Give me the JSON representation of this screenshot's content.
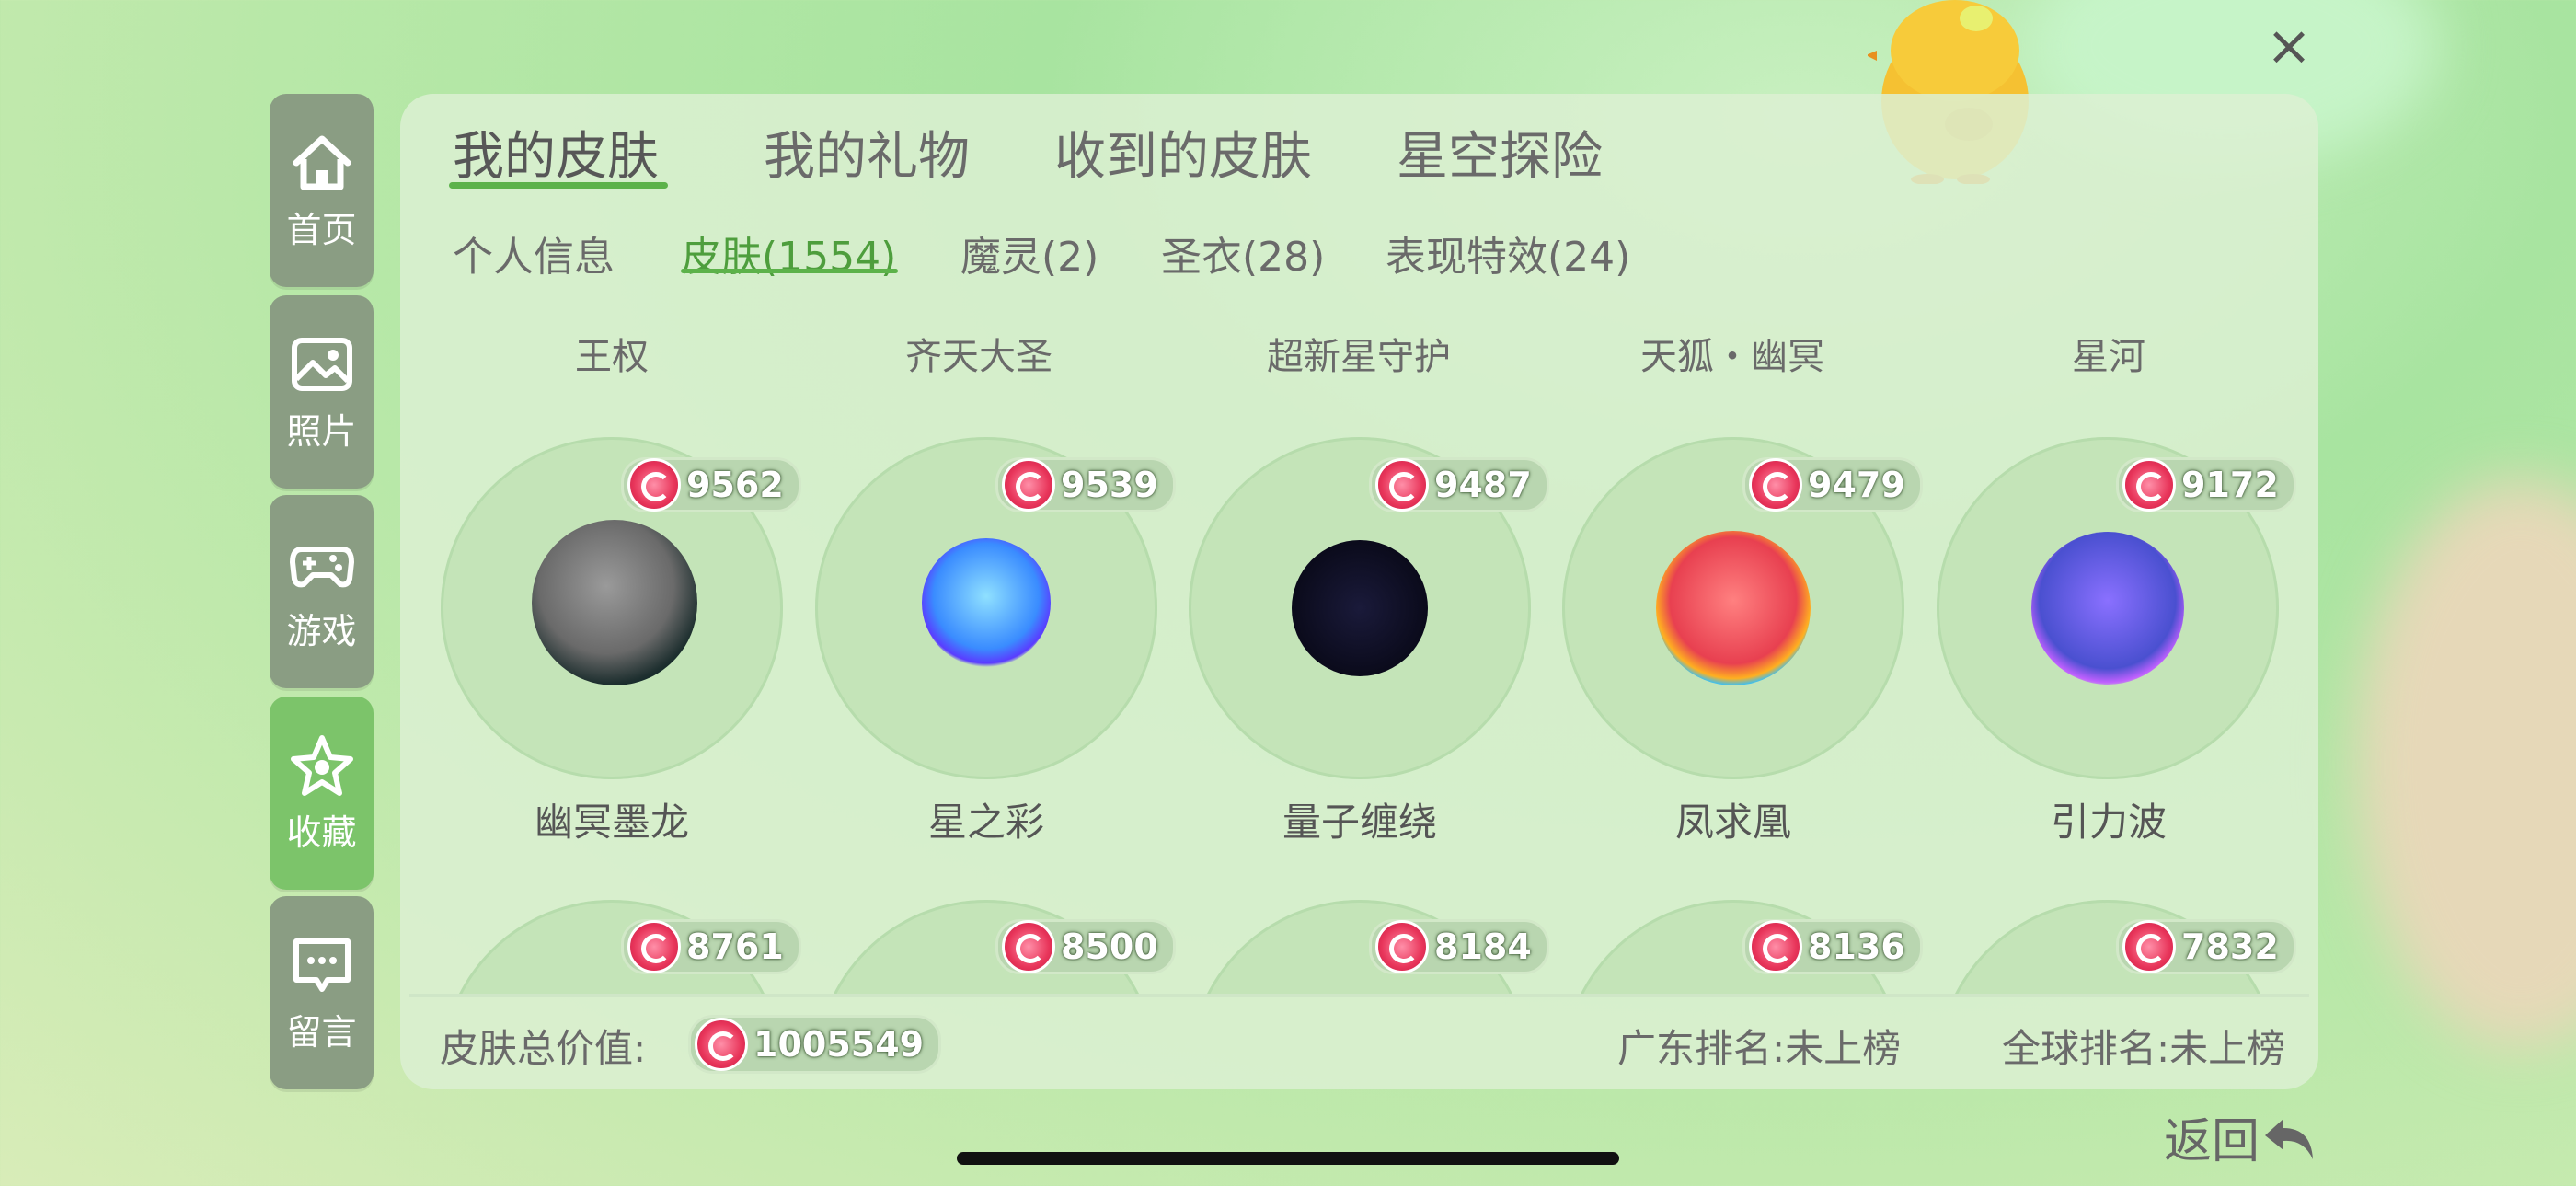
{
  "sidebar": [
    {
      "label": "首页",
      "icon": "home-icon"
    },
    {
      "label": "照片",
      "icon": "photo-icon"
    },
    {
      "label": "游戏",
      "icon": "gamepad-icon"
    },
    {
      "label": "收藏",
      "icon": "star-icon",
      "active": true
    },
    {
      "label": "留言",
      "icon": "message-icon"
    }
  ],
  "tabs": [
    "我的皮肤",
    "我的礼物",
    "收到的皮肤",
    "星空探险"
  ],
  "subtabs": [
    "个人信息",
    "皮肤(1554)",
    "魔灵(2)",
    "圣衣(28)",
    "表现特效(24)"
  ],
  "top_titles": [
    "王权",
    "齐天大圣",
    "超新星守护",
    "天狐・幽冥",
    "星河"
  ],
  "skins": [
    {
      "name": "幽冥墨龙",
      "value": "9562"
    },
    {
      "name": "星之彩",
      "value": "9539"
    },
    {
      "name": "量子缠绕",
      "value": "9487"
    },
    {
      "name": "凤求凰",
      "value": "9479"
    },
    {
      "name": "引力波",
      "value": "9172"
    }
  ],
  "next_row_values": [
    "8761",
    "8500",
    "8184",
    "8136",
    "7832"
  ],
  "footer": {
    "total_label": "皮肤总价值:",
    "total_value": "1005549",
    "guangdong_rank": "广东排名:未上榜",
    "global_rank": "全球排名:未上榜"
  },
  "back_label": "返回",
  "close_label": "×"
}
